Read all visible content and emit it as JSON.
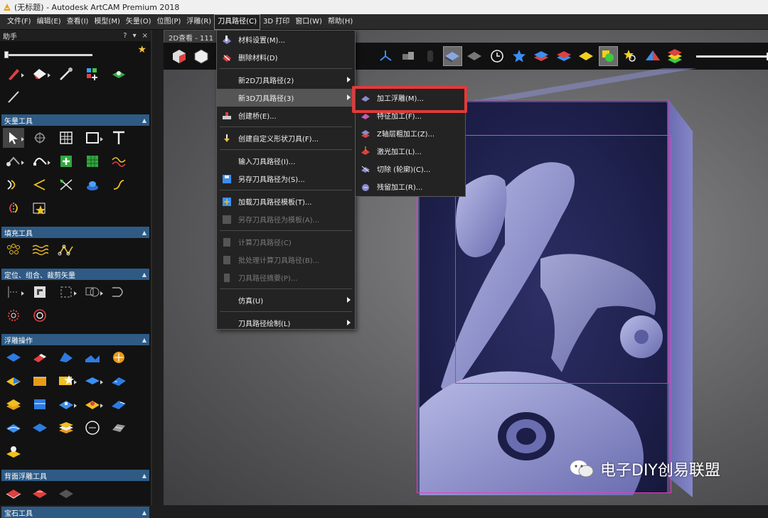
{
  "titlebar": {
    "title": "(无标题) - Autodesk ArtCAM Premium 2018",
    "icon": "artcam-app-icon"
  },
  "menubar": {
    "items": [
      "文件(F)",
      "编辑(E)",
      "查看(I)",
      "模型(M)",
      "矢量(O)",
      "位图(P)",
      "浮雕(R)",
      "刀具路径(C)",
      "3D 打印",
      "窗口(W)",
      "帮助(H)"
    ],
    "active_index": 7
  },
  "sidebar": {
    "title": "助手",
    "header_buttons": [
      "?",
      "▾",
      "×"
    ],
    "sections": {
      "vector_tools": "矢量工具",
      "fill_tools": "填充工具",
      "position_vectors": "定位、组合、裁剪矢量",
      "relief_ops": "浮雕操作",
      "back_relief": "背面浮雕工具",
      "gem_tools": "宝石工具"
    }
  },
  "tabs": {
    "doc_tab": "2D查看 - 111 (4"
  },
  "dropdown": {
    "items": [
      {
        "label": "材料设置(M)...",
        "icon": "material-setup-icon",
        "state": "normal"
      },
      {
        "label": "删除材料(D)",
        "icon": "delete-material-icon",
        "state": "normal"
      },
      {
        "label": "新2D刀具路径(2)",
        "icon": "",
        "state": "submenu"
      },
      {
        "label": "新3D刀具路径(3)",
        "icon": "",
        "state": "submenu-hover"
      },
      {
        "label": "创建桥(E)...",
        "icon": "bridge-icon",
        "state": "normal"
      },
      {
        "label": "创建自定义形状刀具(F)...",
        "icon": "custom-tool-icon",
        "state": "normal"
      },
      {
        "label": "输入刀具路径(I)...",
        "icon": "",
        "state": "normal"
      },
      {
        "label": "另存刀具路径为(S)...",
        "icon": "save-toolpath-icon",
        "state": "normal"
      },
      {
        "label": "加载刀具路径模板(T)...",
        "icon": "load-template-icon",
        "state": "normal"
      },
      {
        "label": "另存刀具路径为模板(A)...",
        "icon": "save-template-icon",
        "state": "disabled"
      },
      {
        "label": "计算刀具路径(C)",
        "icon": "calculate-icon",
        "state": "disabled"
      },
      {
        "label": "批处理计算刀具路径(B)...",
        "icon": "batch-calc-icon",
        "state": "disabled"
      },
      {
        "label": "刀具路径摘要(P)...",
        "icon": "summary-icon",
        "state": "disabled"
      },
      {
        "label": "仿真(U)",
        "icon": "",
        "state": "submenu"
      },
      {
        "label": "刀具路径绘制(L)",
        "icon": "",
        "state": "submenu"
      }
    ]
  },
  "submenu": {
    "items": [
      {
        "label": "加工浮雕(M)...",
        "icon": "machine-relief-icon"
      },
      {
        "label": "特征加工(F)...",
        "icon": "feature-machining-icon"
      },
      {
        "label": "Z轴层粗加工(Z)...",
        "icon": "z-level-roughing-icon"
      },
      {
        "label": "激光加工(L)...",
        "icon": "laser-machining-icon"
      },
      {
        "label": "切除 (轮廓)(C)...",
        "icon": "cut-profile-icon"
      },
      {
        "label": "残留加工(R)...",
        "icon": "rest-machining-icon"
      }
    ]
  },
  "watermark": {
    "text": "电子DIY创易联盟"
  },
  "colors": {
    "accent": "#2e5a84",
    "highlight": "#e23a3a",
    "menu_bg": "#232323",
    "relief": "#2d2f66"
  }
}
